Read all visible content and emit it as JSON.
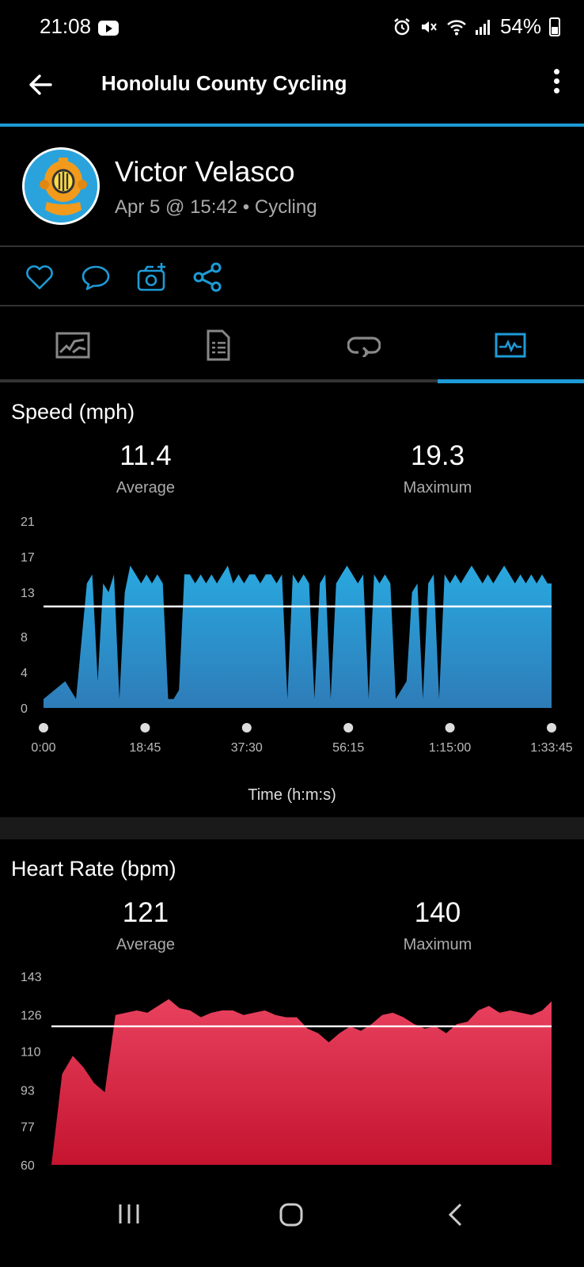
{
  "status": {
    "time": "21:08",
    "battery": "54%"
  },
  "app_bar": {
    "title": "Honolulu County Cycling"
  },
  "profile": {
    "name": "Victor Velasco",
    "meta": "Apr 5 @ 15:42 • Cycling"
  },
  "colors": {
    "accent": "#1e9bd7",
    "speed": "#29a8df",
    "heart": "#e0344e"
  },
  "icons": {
    "actions": [
      "heart-icon",
      "comment-icon",
      "add-photo-icon",
      "share-icon"
    ],
    "tabs": [
      "map-icon",
      "details-icon",
      "laps-icon",
      "charts-icon"
    ]
  },
  "speed": {
    "title": "Speed (mph)",
    "avg_value": "11.4",
    "avg_label": "Average",
    "max_value": "19.3",
    "max_label": "Maximum",
    "xlabel": "Time (h:m:s)"
  },
  "heart": {
    "title": "Heart Rate (bpm)",
    "avg_value": "121",
    "avg_label": "Average",
    "max_value": "140",
    "max_label": "Maximum"
  },
  "chart_data": [
    {
      "type": "area",
      "title": "Speed (mph)",
      "xlabel": "Time (h:m:s)",
      "ylabel": "",
      "ylim": [
        0,
        21
      ],
      "yticks": [
        "0",
        "4",
        "8",
        "13",
        "17",
        "21"
      ],
      "xticks": [
        "0:00",
        "18:45",
        "37:30",
        "56:15",
        "1:15:00",
        "1:33:45"
      ],
      "x_minutes": [
        0,
        2,
        4,
        6,
        8,
        9,
        10,
        11,
        12,
        13,
        14,
        15,
        16,
        17,
        18,
        19,
        20,
        21,
        22,
        23,
        24,
        25,
        26,
        27,
        28,
        29,
        30,
        31,
        32,
        33,
        34,
        35,
        36,
        37,
        38,
        39,
        40,
        41,
        42,
        43,
        44,
        45,
        46,
        47,
        48,
        49,
        50,
        51,
        52,
        53,
        54,
        55,
        56,
        57,
        58,
        59,
        60,
        61,
        62,
        63,
        64,
        65,
        66,
        67,
        68,
        69,
        70,
        71,
        72,
        73,
        74,
        75,
        76,
        77,
        78,
        79,
        80,
        81,
        82,
        83,
        84,
        85,
        86,
        87,
        88,
        89,
        90,
        91,
        92,
        93,
        93.75
      ],
      "values": [
        1,
        2,
        3,
        1,
        14,
        15,
        3,
        14,
        13,
        15,
        1,
        13,
        16,
        15,
        14,
        15,
        14,
        15,
        14,
        1,
        1,
        2,
        15,
        15,
        14,
        15,
        14,
        15,
        14,
        15,
        16,
        14,
        15,
        14,
        15,
        15,
        14,
        15,
        15,
        14,
        15,
        1,
        15,
        14,
        15,
        14,
        1,
        14,
        15,
        1,
        14,
        15,
        16,
        15,
        14,
        15,
        1,
        15,
        14,
        15,
        14,
        1,
        2,
        3,
        13,
        14,
        1,
        14,
        15,
        1,
        15,
        14,
        15,
        14,
        15,
        16,
        15,
        14,
        15,
        14,
        15,
        16,
        15,
        14,
        15,
        14,
        15,
        14,
        15,
        14,
        14
      ],
      "average": 11.4,
      "maximum": 19.3
    },
    {
      "type": "area",
      "title": "Heart Rate (bpm)",
      "ylim": [
        60,
        143
      ],
      "yticks": [
        "60",
        "77",
        "93",
        "110",
        "126",
        "143"
      ],
      "x_minutes": [
        0,
        2,
        4,
        6,
        8,
        10,
        12,
        14,
        16,
        18,
        20,
        22,
        24,
        26,
        28,
        30,
        32,
        34,
        36,
        38,
        40,
        42,
        44,
        46,
        48,
        50,
        52,
        54,
        56,
        58,
        60,
        62,
        64,
        66,
        68,
        70,
        72,
        74,
        76,
        78,
        80,
        82,
        84,
        86,
        88,
        90,
        92,
        93.75
      ],
      "values": [
        60,
        100,
        108,
        103,
        96,
        92,
        126,
        127,
        128,
        127,
        130,
        133,
        129,
        128,
        125,
        127,
        128,
        128,
        126,
        127,
        128,
        126,
        125,
        125,
        120,
        118,
        114,
        118,
        121,
        119,
        122,
        126,
        127,
        125,
        122,
        120,
        121,
        118,
        122,
        123,
        128,
        130,
        127,
        128,
        127,
        126,
        128,
        132
      ],
      "average": 121,
      "maximum": 140
    }
  ]
}
